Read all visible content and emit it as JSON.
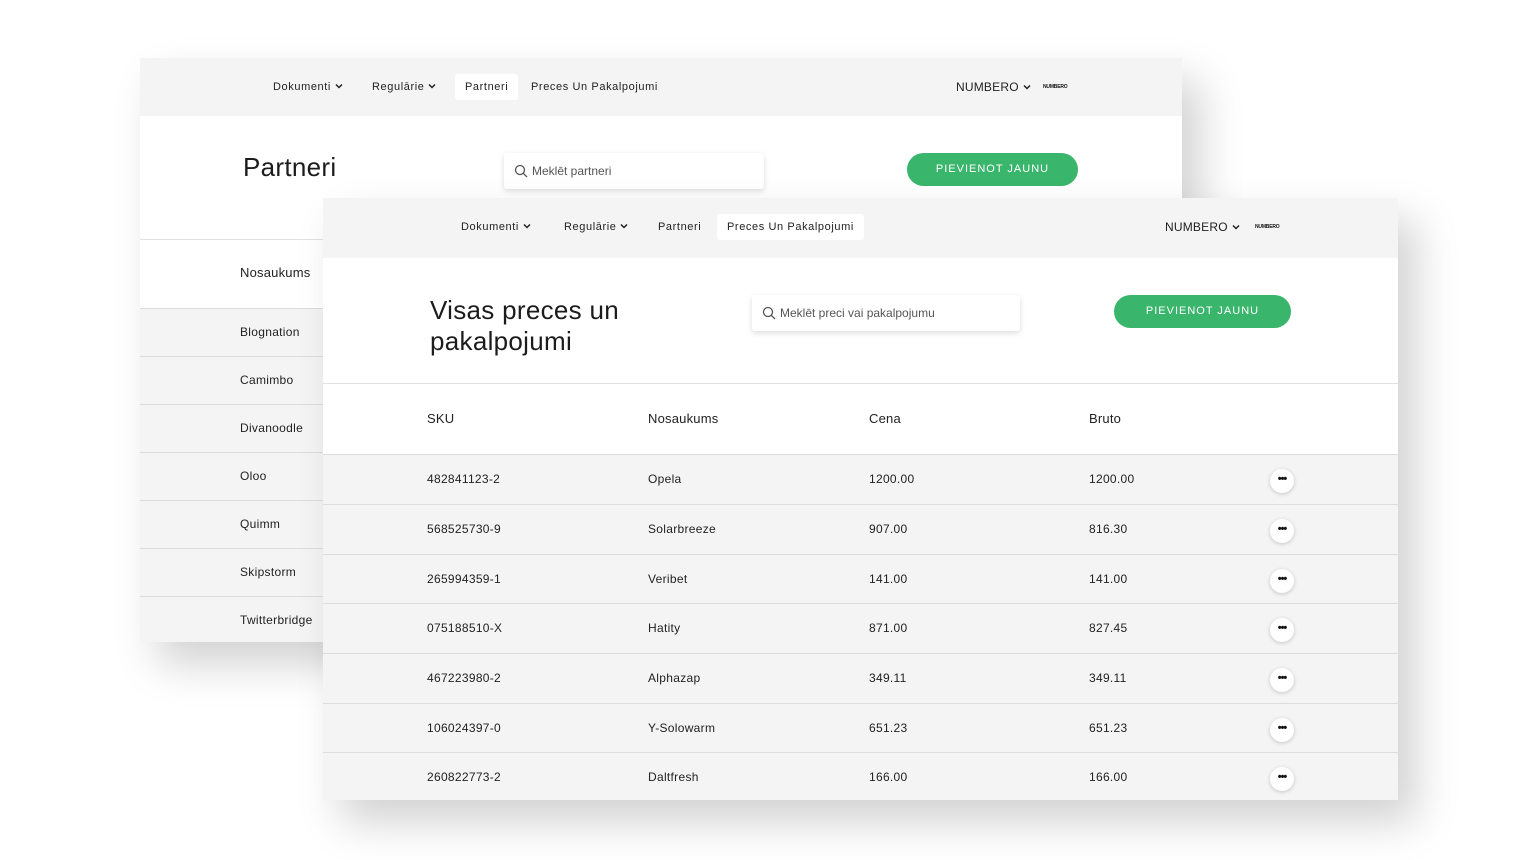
{
  "back_window": {
    "nav": [
      {
        "label": "Dokumenti",
        "dropdown": true,
        "active": false
      },
      {
        "label": "Regulārie",
        "dropdown": true,
        "active": false
      },
      {
        "label": "Partneri",
        "dropdown": false,
        "active": true
      },
      {
        "label": "Preces Un Pakalpojumi",
        "dropdown": false,
        "active": false
      }
    ],
    "brand": "NUMBERO",
    "logo": "NUMBERO",
    "title": "Partneri",
    "search_placeholder": "Meklēt partneri",
    "add_button": "PIEVIENOT JAUNU",
    "column": "Nosaukums",
    "rows": [
      "Blognation",
      "Camimbo",
      "Divanoodle",
      "Oloo",
      "Quimm",
      "Skipstorm",
      "Twitterbridge"
    ]
  },
  "front_window": {
    "nav": [
      {
        "label": "Dokumenti",
        "dropdown": true,
        "active": false
      },
      {
        "label": "Regulārie",
        "dropdown": true,
        "active": false
      },
      {
        "label": "Partneri",
        "dropdown": false,
        "active": false
      },
      {
        "label": "Preces Un Pakalpojumi",
        "dropdown": false,
        "active": true
      }
    ],
    "brand": "NUMBERO",
    "logo": "NUMBERO",
    "title_line1": "Visas preces un",
    "title_line2": "pakalpojumi",
    "search_placeholder": "Meklēt preci vai pakalpojumu",
    "add_button": "PIEVIENOT JAUNU",
    "columns": [
      "SKU",
      "Nosaukums",
      "Cena",
      "Bruto"
    ],
    "rows": [
      {
        "sku": "482841123-2",
        "name": "Opela",
        "price": "1200.00",
        "gross": "1200.00"
      },
      {
        "sku": "568525730-9",
        "name": "Solarbreeze",
        "price": "907.00",
        "gross": "816.30"
      },
      {
        "sku": "265994359-1",
        "name": "Veribet",
        "price": "141.00",
        "gross": "141.00"
      },
      {
        "sku": "075188510-X",
        "name": "Hatity",
        "price": "871.00",
        "gross": "827.45"
      },
      {
        "sku": "467223980-2",
        "name": "Alphazap",
        "price": "349.11",
        "gross": "349.11"
      },
      {
        "sku": "106024397-0",
        "name": "Y-Solowarm",
        "price": "651.23",
        "gross": "651.23"
      },
      {
        "sku": "260822773-2",
        "name": "Daltfresh",
        "price": "166.00",
        "gross": "166.00"
      }
    ],
    "row_action_icon": "more-dots-icon",
    "accent_color": "#3ab56c"
  }
}
